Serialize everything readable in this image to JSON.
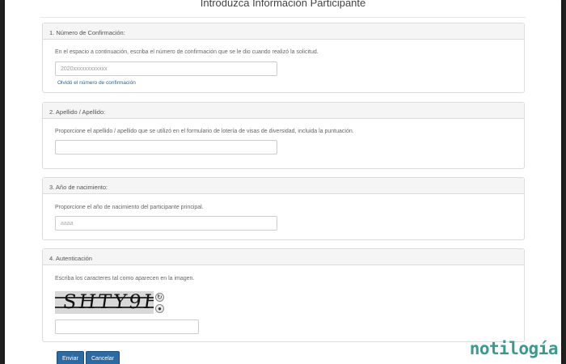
{
  "page": {
    "title": "Introduzca Información Participante"
  },
  "sections": [
    {
      "heading": "1. Número de Confirmación:",
      "help": "En el espacio a continuación, escriba el número de confirmación que se le dio cuando realizó la solicitud.",
      "input_value": "2020xxxxxxxxxxxx",
      "link": "Olvidó el número de confirmación"
    },
    {
      "heading": "2. Apellido / Apellido:",
      "help": "Proporcione el apellido / apellido que se utilizó en el formulario de lotería de visas de diversidad, incluida la puntuación.",
      "input_value": ""
    },
    {
      "heading": "3. Año de nacimiento:",
      "help": "Proporcione el año de nacimiento del participante principal.",
      "input_placeholder": "aaaa"
    },
    {
      "heading": "4. Autenticación",
      "help": "Escriba los caracteres tal como aparecen en la imagen.",
      "captcha_text": "SHTY9H",
      "input_value": ""
    }
  ],
  "buttons": {
    "submit": "Enviar",
    "cancel": "Cancelar"
  },
  "watermark": "notilogía",
  "icons": {
    "refresh": "refresh-icon",
    "audio": "audio-icon"
  },
  "colors": {
    "primary_button": "#2c6aa3",
    "link": "#2a6496",
    "watermark": "#3a9a8e"
  }
}
